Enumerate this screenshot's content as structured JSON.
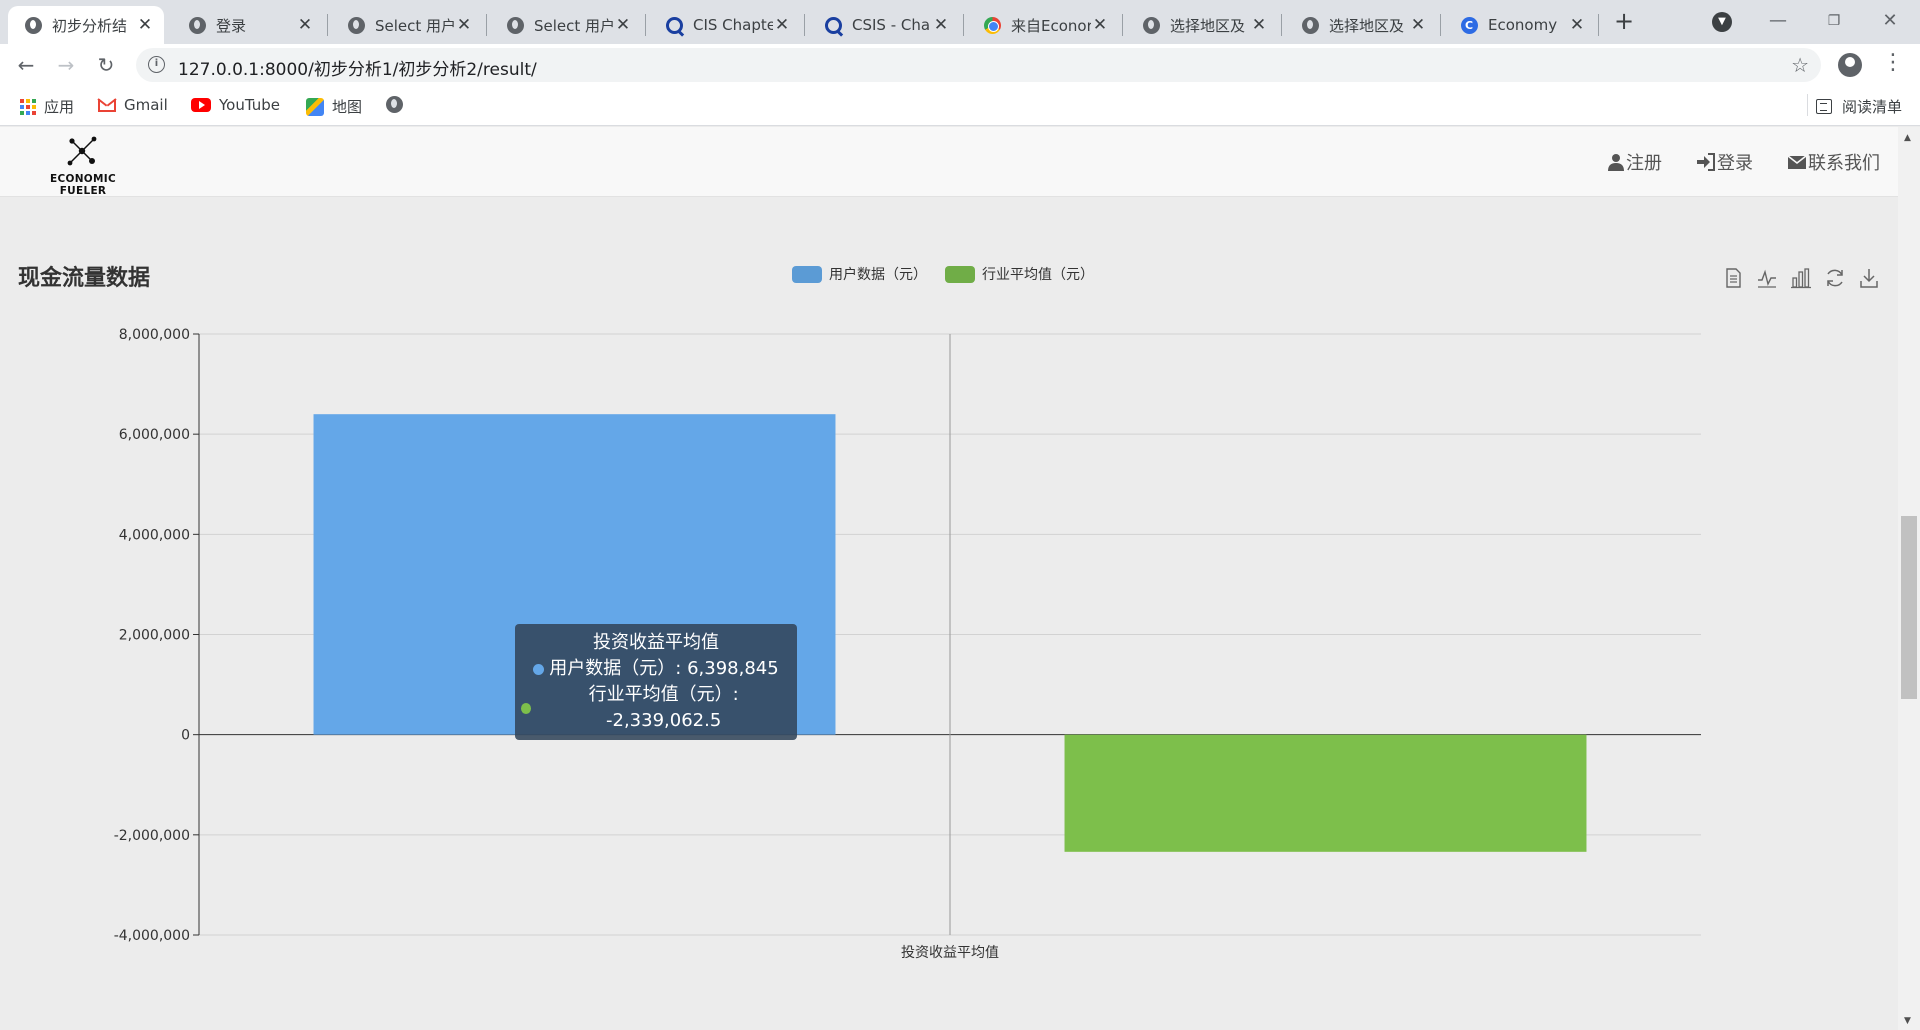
{
  "browser": {
    "tabs": [
      {
        "title": "初步分析结",
        "icon": "globe-icon",
        "active": true
      },
      {
        "title": "登录",
        "icon": "globe-icon",
        "active": false
      },
      {
        "title": "Select 用户",
        "icon": "globe-icon",
        "active": false
      },
      {
        "title": "Select 用户",
        "icon": "globe-icon",
        "active": false
      },
      {
        "title": "CIS Chapte",
        "icon": "q-logo-icon",
        "active": false
      },
      {
        "title": "CSIS - Cha",
        "icon": "q-logo-icon",
        "active": false
      },
      {
        "title": "来自Econor",
        "icon": "chrome-logo-icon",
        "active": false
      },
      {
        "title": "选择地区及",
        "icon": "globe-icon",
        "active": false
      },
      {
        "title": "选择地区及",
        "icon": "globe-icon",
        "active": false
      },
      {
        "title": "Economy",
        "icon": "c-logo-icon",
        "active": false
      }
    ],
    "url": "127.0.0.1:8000/初步分析1/初步分析2/result/",
    "bookmarks": [
      {
        "label": "应用",
        "icon": "apps-grid-icon"
      },
      {
        "label": "Gmail",
        "icon": "gmail-icon"
      },
      {
        "label": "YouTube",
        "icon": "youtube-icon"
      },
      {
        "label": "地图",
        "icon": "maps-icon"
      },
      {
        "label": "",
        "icon": "globe-icon"
      }
    ],
    "reading_list": "阅读清单"
  },
  "site": {
    "brand": "ECONOMIC FUELER",
    "nav": {
      "register": "注册",
      "login": "登录",
      "contact": "联系我们"
    }
  },
  "tooltip": {
    "title": "投资收益平均值",
    "rows": [
      {
        "label": "用户数据（元）: 6,398,845",
        "color": "#64a7e8"
      },
      {
        "label": "行业平均值（元）: -2,339,062.5",
        "color": "#7dbf4b"
      }
    ]
  },
  "chart_data": {
    "type": "bar",
    "title": "现金流量数据",
    "categories": [
      "投资收益平均值"
    ],
    "series": [
      {
        "name": "用户数据（元）",
        "values": [
          6398845
        ],
        "color": "#64a7e8"
      },
      {
        "name": "行业平均值（元）",
        "values": [
          -2339062.5
        ],
        "color": "#7dbf4b"
      }
    ],
    "legend_swatch_colors": [
      "#5b9bd5",
      "#70ad47"
    ],
    "ylim": [
      -4000000,
      8000000
    ],
    "yticks": [
      "8,000,000",
      "6,000,000",
      "4,000,000",
      "2,000,000",
      "0",
      "-2,000,000",
      "-4,000,000"
    ],
    "ytick_values": [
      8000000,
      6000000,
      4000000,
      2000000,
      0,
      -2000000,
      -4000000
    ],
    "grid": true,
    "legend_position": "top-center",
    "xlabel": "",
    "ylabel": ""
  }
}
